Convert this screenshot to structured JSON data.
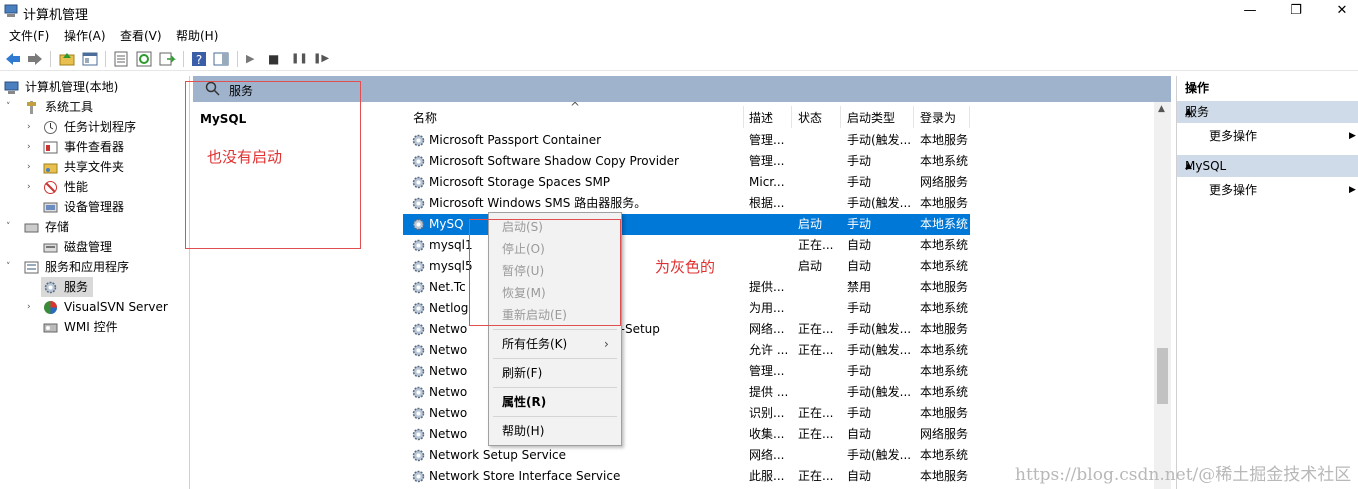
{
  "window": {
    "title": "计算机管理",
    "minimize_glyph": "—",
    "maximize_glyph": "❐",
    "close_glyph": "✕"
  },
  "menu": [
    "文件(F)",
    "操作(A)",
    "查看(V)",
    "帮助(H)"
  ],
  "toolbar": {
    "icons": [
      "back-icon",
      "forward-icon",
      "up-folder-icon",
      "show-hide-tree-icon",
      "properties-icon",
      "refresh-icon",
      "export-icon",
      "help-icon",
      "view-icon",
      "play-icon",
      "stop-icon",
      "pause-icon",
      "restart-icon"
    ],
    "play_glyph": "▶",
    "stop_glyph": "■",
    "pause_glyph": "❚❚",
    "restart_glyph": "❚▶"
  },
  "tree": {
    "root": "计算机管理(本地)",
    "system_tools": "系统工具",
    "task_scheduler": "任务计划程序",
    "event_viewer": "事件查看器",
    "shared_folders": "共享文件夹",
    "performance": "性能",
    "device_manager": "设备管理器",
    "storage": "存储",
    "disk_management": "磁盘管理",
    "services_apps": "服务和应用程序",
    "services": "服务",
    "visualsvn": "VisualSVN Server",
    "wmi": "WMI 控件",
    "collapsed_arrow": "›",
    "expanded_arrow": "˅"
  },
  "center": {
    "header": "服务",
    "detail_title": "MySQL",
    "annotation_left": "也没有启动",
    "annotation_right": "为灰色的",
    "sort_glyph": "^",
    "columns": {
      "name": "名称",
      "desc": "描述",
      "status": "状态",
      "startup": "启动类型",
      "logon": "登录为"
    },
    "rows": [
      {
        "name": "Microsoft Passport Container",
        "desc": "管理...",
        "status": "",
        "startup": "手动(触发...",
        "logon": "本地服务"
      },
      {
        "name": "Microsoft Software Shadow Copy Provider",
        "desc": "管理...",
        "status": "",
        "startup": "手动",
        "logon": "本地系统"
      },
      {
        "name": "Microsoft Storage Spaces SMP",
        "desc": "Micr...",
        "status": "",
        "startup": "手动",
        "logon": "网络服务"
      },
      {
        "name": "Microsoft Windows SMS 路由器服务。",
        "desc": "根据...",
        "status": "",
        "startup": "手动(触发...",
        "logon": "本地服务"
      },
      {
        "name": "MySQ",
        "desc": "",
        "status": "启动",
        "startup": "手动",
        "logon": "本地系统"
      },
      {
        "name": "mysql1",
        "desc": "",
        "status": "正在...",
        "startup": "自动",
        "logon": "本地系统"
      },
      {
        "name": "mysql5",
        "desc": "",
        "status": "启动",
        "startup": "自动",
        "logon": "本地系统"
      },
      {
        "name": "Net.Tc",
        "desc": "提供...",
        "status": "",
        "startup": "禁用",
        "logon": "本地服务"
      },
      {
        "name": "Netlog",
        "desc": "为用...",
        "status": "",
        "startup": "手动",
        "logon": "本地系统"
      },
      {
        "name": "Netwo",
        "desc": "网络...",
        "status": "正在...",
        "startup": "手动(触发...",
        "logon": "本地服务",
        "suffix": "p-Setup"
      },
      {
        "name": "Netwo",
        "desc": "允许 ...",
        "status": "正在...",
        "startup": "手动(触发...",
        "logon": "本地系统"
      },
      {
        "name": "Netwo",
        "desc": "管理...",
        "status": "",
        "startup": "手动",
        "logon": "本地系统"
      },
      {
        "name": "Netwo",
        "desc": "提供 ...",
        "status": "",
        "startup": "手动(触发...",
        "logon": "本地系统"
      },
      {
        "name": "Netwo",
        "desc": "识别...",
        "status": "正在...",
        "startup": "手动",
        "logon": "本地服务"
      },
      {
        "name": "Netwo",
        "desc": "收集...",
        "status": "正在...",
        "startup": "自动",
        "logon": "网络服务"
      },
      {
        "name": "Network Setup Service",
        "desc": "网络...",
        "status": "",
        "startup": "手动(触发...",
        "logon": "本地系统"
      },
      {
        "name": "Network Store Interface Service",
        "desc": "此服...",
        "status": "正在...",
        "startup": "自动",
        "logon": "本地服务"
      }
    ]
  },
  "context_menu": {
    "start": "启动(S)",
    "stop": "停止(O)",
    "pause": "暂停(U)",
    "resume": "恢复(M)",
    "restart": "重新启动(E)",
    "all_tasks": "所有任务(K)",
    "submenu_arrow": "›",
    "refresh": "刷新(F)",
    "properties": "属性(R)",
    "help": "帮助(H)"
  },
  "actions": {
    "title": "操作",
    "section_services": "服务",
    "more_actions_1": "更多操作",
    "section_mysql": "MySQL",
    "more_actions_2": "更多操作",
    "collapse_glyph": "▲",
    "more_glyph": "▶"
  },
  "watermark": "https://blog.csdn.net/@稀土掘金技术社区",
  "colors": {
    "header_bar": "#9fb4cc",
    "selection": "#0078d7",
    "annotation_red": "#e03030",
    "action_header": "#cfdbe8"
  }
}
